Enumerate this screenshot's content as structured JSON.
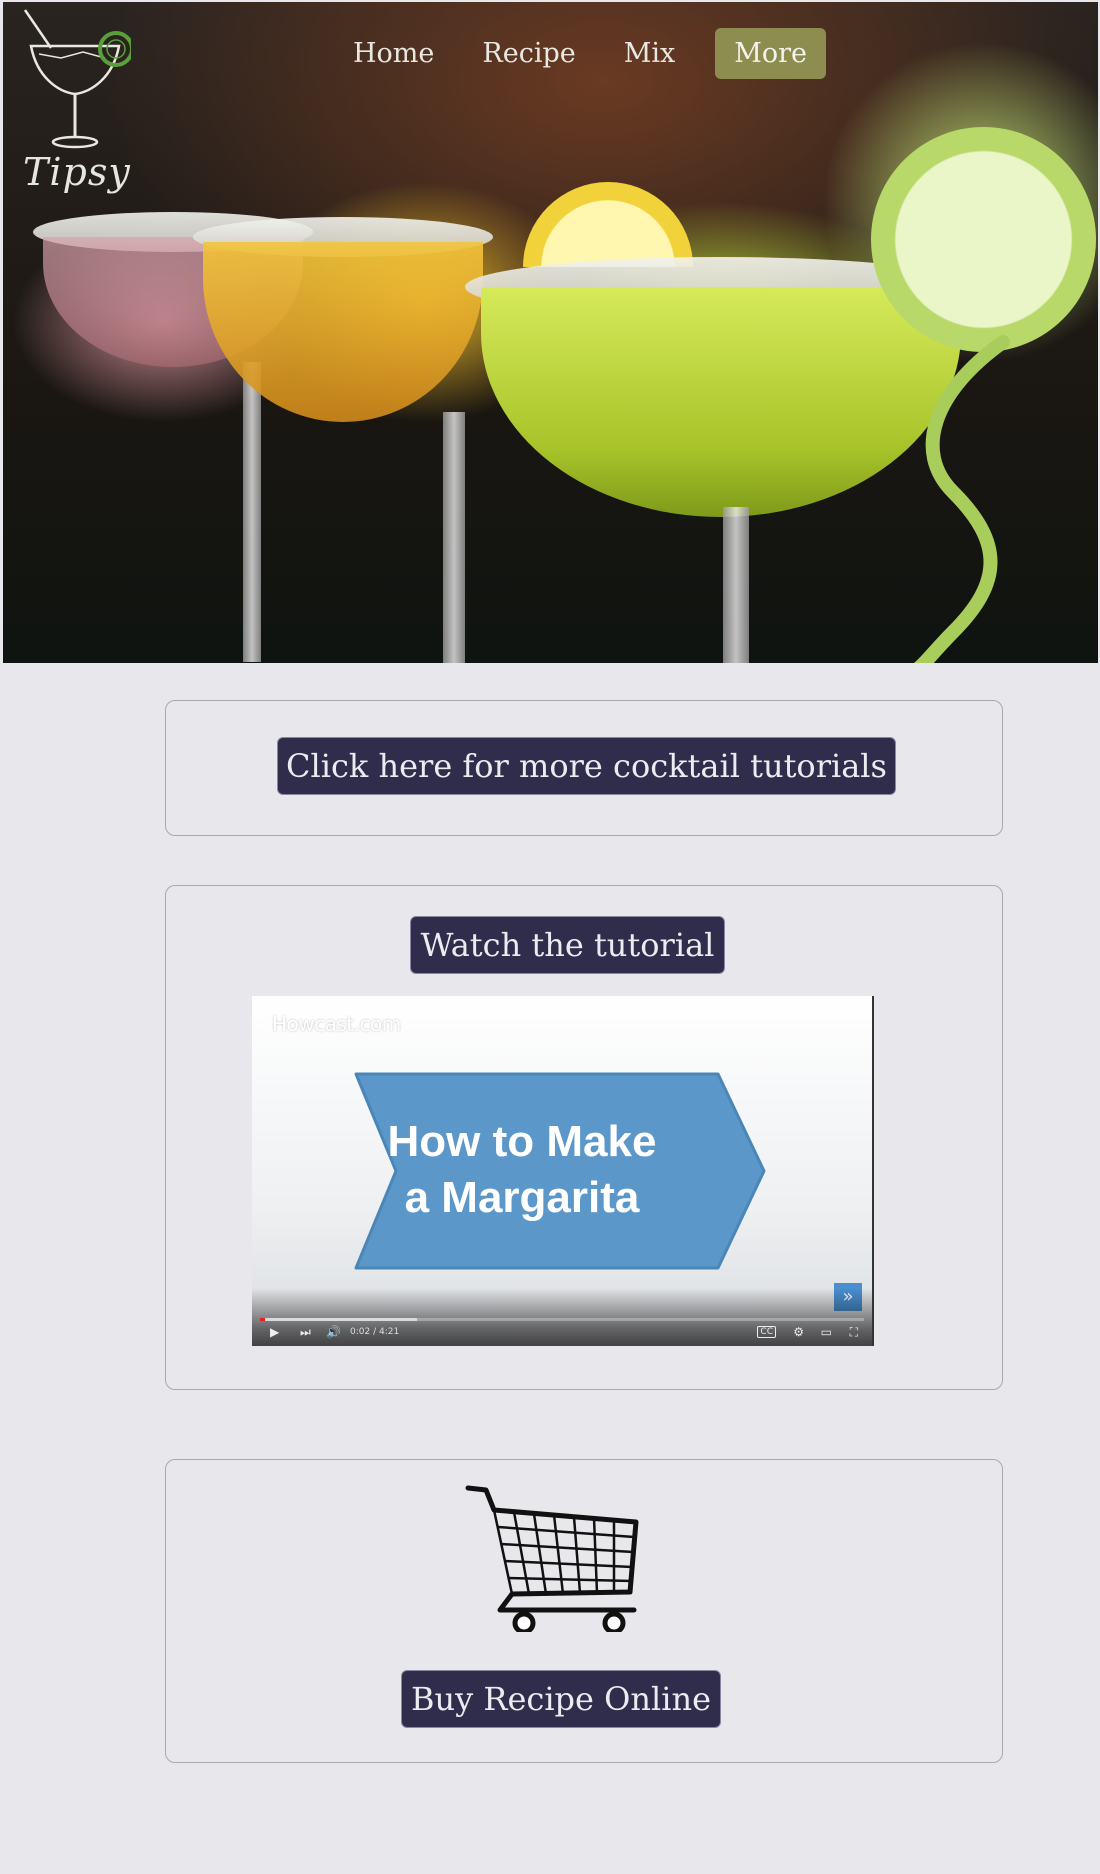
{
  "brand": {
    "name": "Tipsy"
  },
  "nav": {
    "items": [
      {
        "label": "Home"
      },
      {
        "label": "Recipe"
      },
      {
        "label": "Mix"
      }
    ],
    "more_label": "More",
    "more_color": "#8d8d4f"
  },
  "tutorials_button": {
    "label": "Click here for more cocktail tutorials"
  },
  "video_section": {
    "button_label": "Watch the tutorial",
    "video": {
      "watermark": "Howcast.com",
      "title_line1": "How to Make",
      "title_line2": "a Margarita",
      "time": "0:02 / 4:21",
      "progress": 0.008,
      "buffered": 0.26,
      "accent": "#5b97c9"
    }
  },
  "buy_section": {
    "icon": "shopping-cart-icon",
    "button_label": "Buy Recipe Online"
  },
  "colors": {
    "page_bg": "#e8e8ec",
    "button_bg": "#302c4c",
    "button_text": "#ebebf0"
  }
}
